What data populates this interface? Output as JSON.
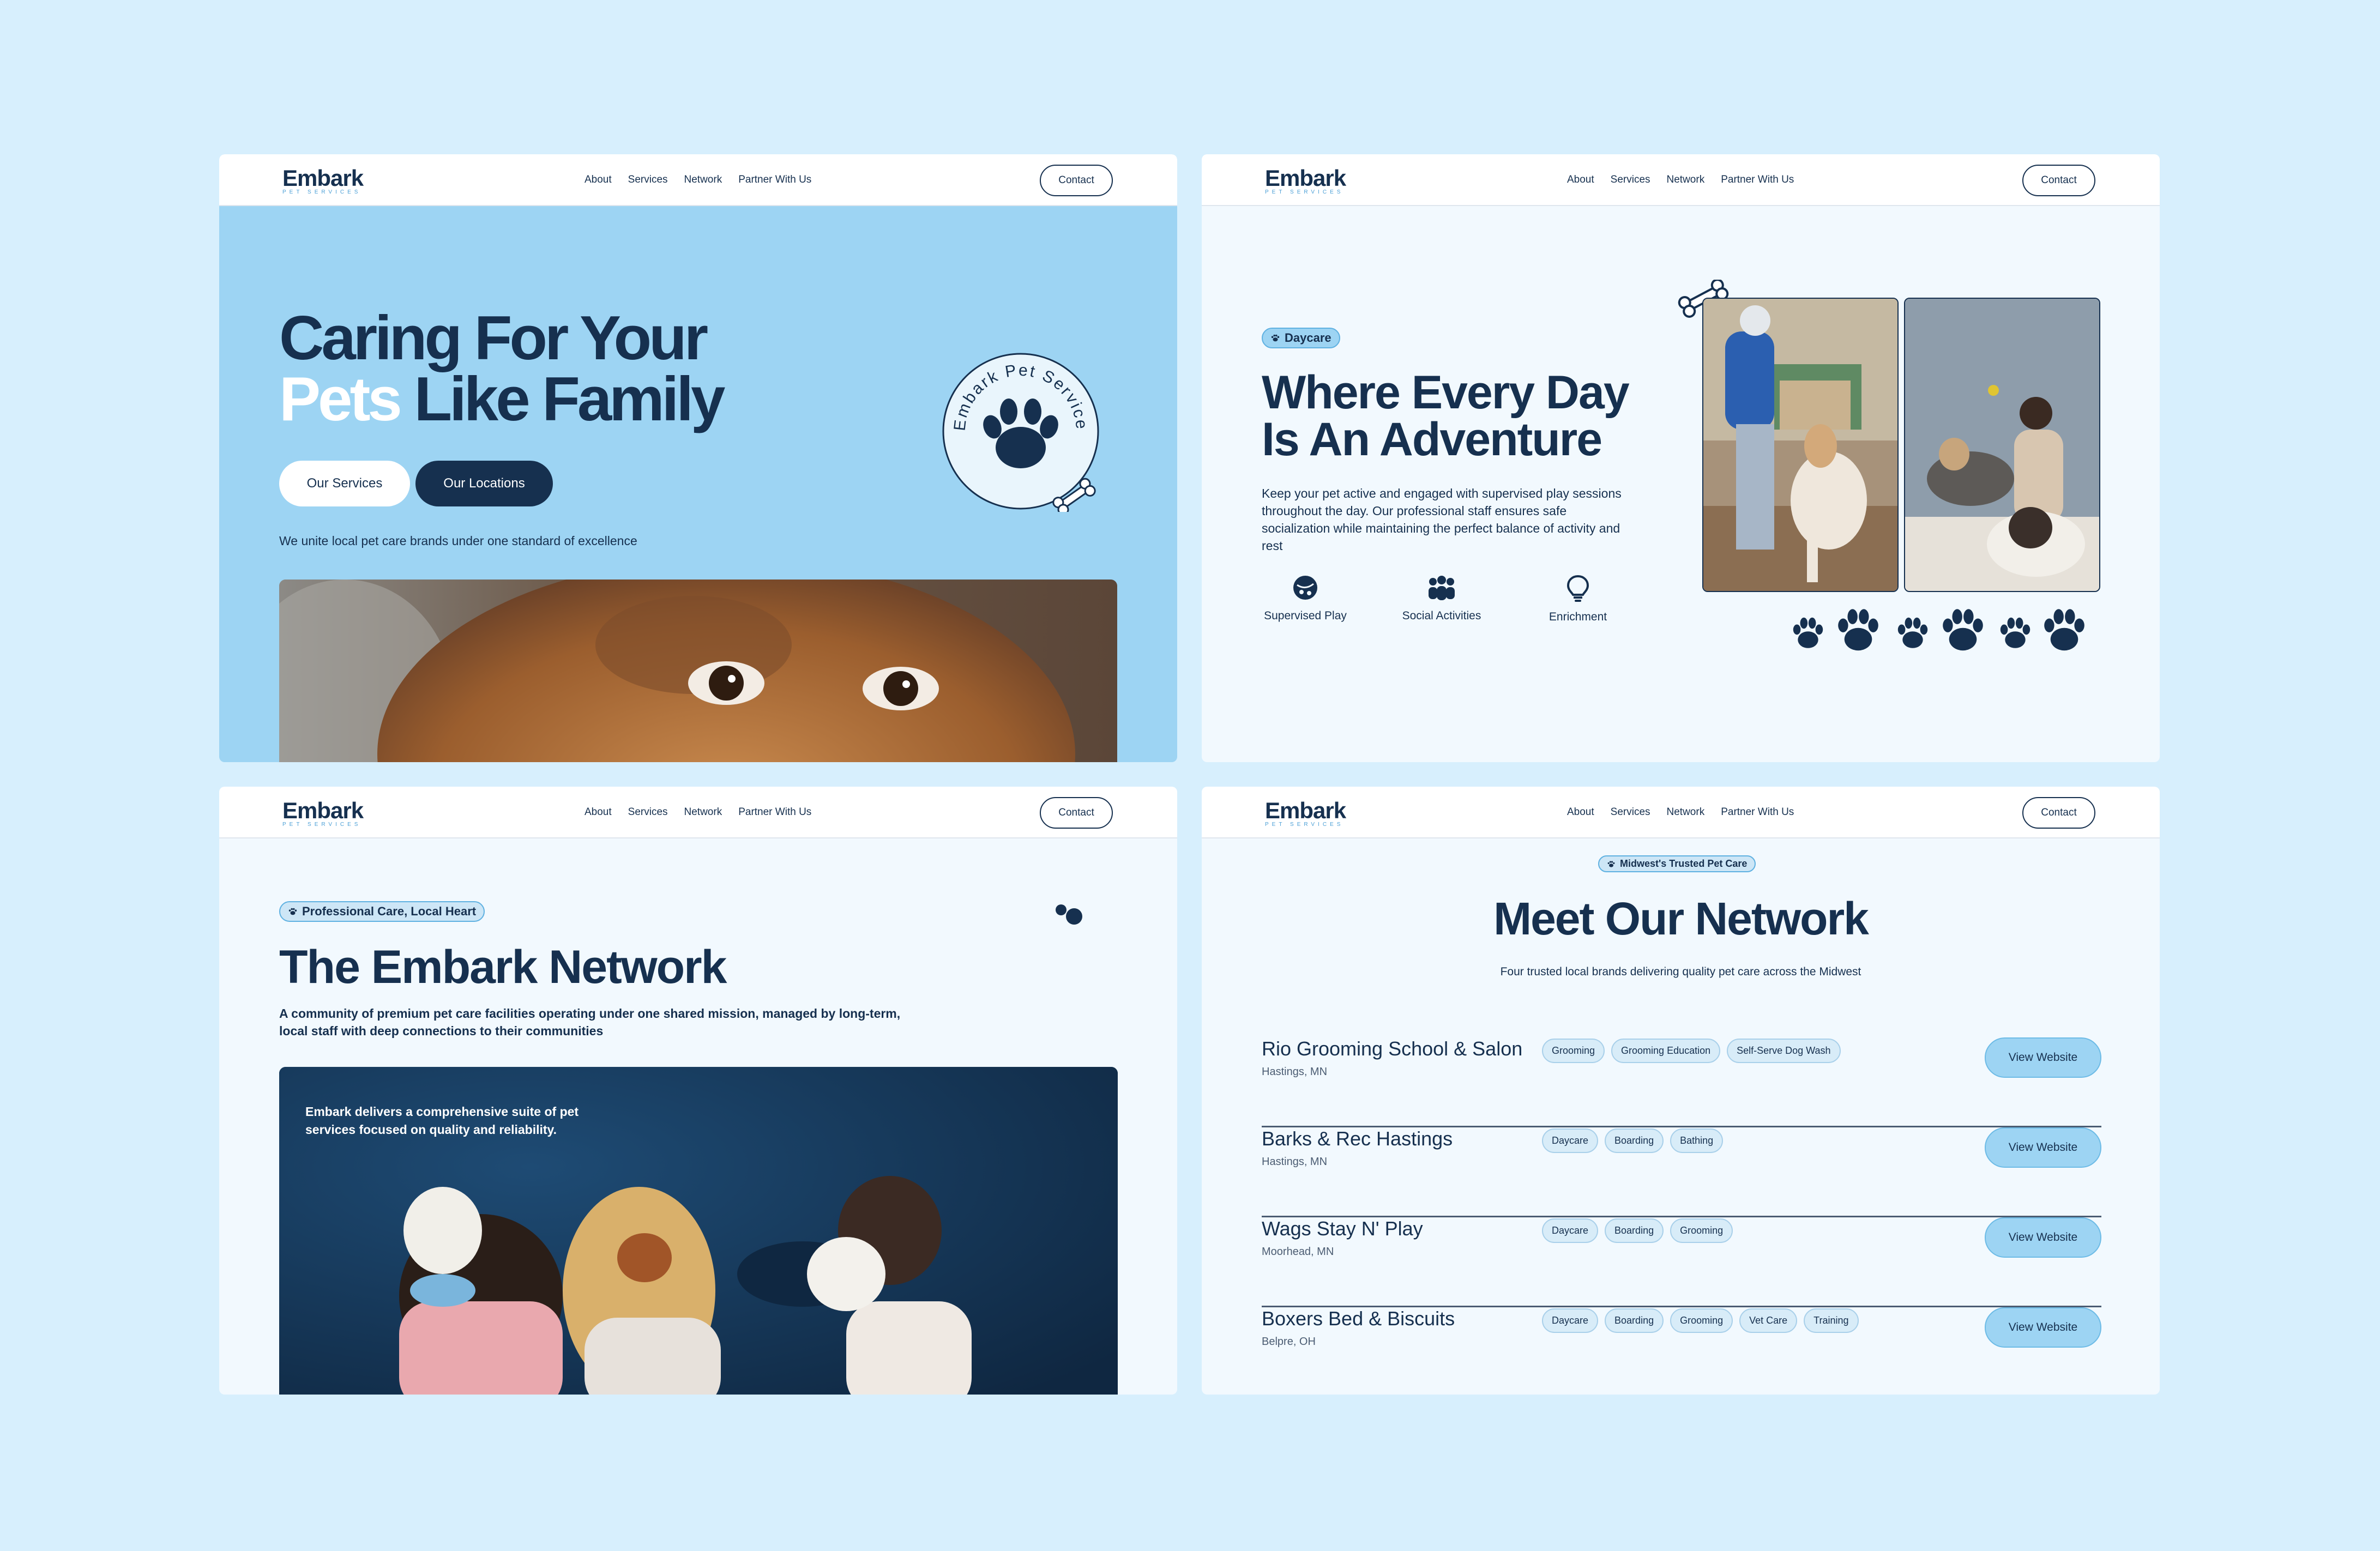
{
  "brand": {
    "name": "Embark",
    "tagline": "PET SERVICES"
  },
  "nav": {
    "links": [
      "About",
      "Services",
      "Network",
      "Partner With Us"
    ],
    "contact": "Contact"
  },
  "hero": {
    "title_line1": "Caring For Your",
    "title_line2_accent": "Pets",
    "title_line2_rest": " Like Family",
    "btn_services": "Our Services",
    "btn_locations": "Our Locations",
    "subtitle": "We unite local pet care brands under one standard of excellence",
    "seal_text": "Embark Pet Services"
  },
  "daycare": {
    "badge": "Daycare",
    "title_line1": "Where Every Day",
    "title_line2": "Is An Adventure",
    "body": "Keep your pet active and engaged with supervised play sessions throughout the day. Our professional staff ensures safe socialization while maintaining the perfect balance of activity and rest",
    "features": [
      {
        "label": "Supervised Play",
        "icon": "ball-icon"
      },
      {
        "label": "Social Activities",
        "icon": "group-icon"
      },
      {
        "label": "Enrichment",
        "icon": "lightbulb-icon"
      }
    ]
  },
  "network_intro": {
    "badge": "Professional Care, Local Heart",
    "title": "The Embark Network",
    "body": "A community of premium pet care facilities operating under one shared mission, managed by long-term, local staff with deep connections to their communities",
    "photo_caption": "Embark delivers a comprehensive suite of pet services focused on quality and reliability."
  },
  "network_list": {
    "badge": "Midwest's Trusted Pet Care",
    "title": "Meet Our Network",
    "subtitle": "Four trusted local brands delivering quality pet care across the Midwest",
    "button_label": "View Website",
    "items": [
      {
        "name": "Rio Grooming School & Salon",
        "location": "Hastings, MN",
        "tags": [
          "Grooming",
          "Grooming Education",
          "Self-Serve Dog Wash"
        ]
      },
      {
        "name": "Barks & Rec Hastings",
        "location": "Hastings, MN",
        "tags": [
          "Daycare",
          "Boarding",
          "Bathing"
        ]
      },
      {
        "name": "Wags Stay N' Play",
        "location": "Moorhead, MN",
        "tags": [
          "Daycare",
          "Boarding",
          "Grooming"
        ]
      },
      {
        "name": "Boxers Bed & Biscuits",
        "location": "Belpre, OH",
        "tags": [
          "Daycare",
          "Boarding",
          "Grooming",
          "Vet Care",
          "Training"
        ]
      }
    ]
  },
  "colors": {
    "navy": "#16304f",
    "sky": "#9dd4f3",
    "page_bg": "#d7effd",
    "panel_bg": "#f2f9fe"
  }
}
